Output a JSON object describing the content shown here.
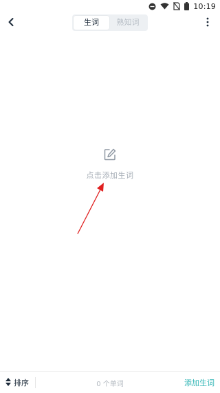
{
  "status_bar": {
    "time": "10:19",
    "icons": [
      "minus-circle-icon",
      "wifi-icon",
      "no-sim-icon",
      "battery-icon"
    ]
  },
  "nav": {
    "back_icon": "chevron-left-icon",
    "tabs": [
      {
        "label": "生词",
        "active": true
      },
      {
        "label": "熟知词",
        "active": false
      }
    ],
    "more_icon": "more-vertical-icon"
  },
  "empty_state": {
    "icon": "edit-icon",
    "text": "点击添加生词"
  },
  "bottom_bar": {
    "sort_icon": "sort-updown-icon",
    "sort_label": "排序",
    "word_count": "0 个单词",
    "add_label": "添加生词"
  },
  "colors": {
    "accent": "#2bb3b3",
    "muted_text": "#a6adb6",
    "annotation_arrow": "#e02020"
  }
}
